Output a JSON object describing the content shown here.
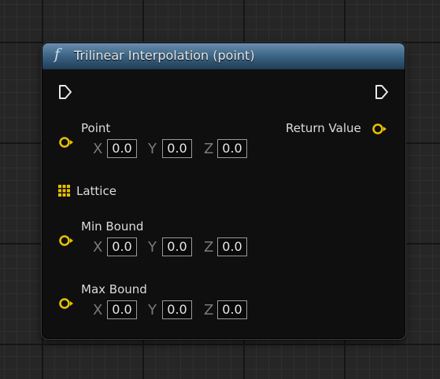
{
  "node": {
    "title": "Trilinear Interpolation (point)",
    "function_icon": "f",
    "header_color": "#3f6788",
    "pin_color": "#e8c000"
  },
  "inputs": {
    "point": {
      "label": "Point",
      "x_label": "X",
      "y_label": "Y",
      "z_label": "Z",
      "x": "0.0",
      "y": "0.0",
      "z": "0.0",
      "icon": "vector-pin-icon"
    },
    "lattice": {
      "label": "Lattice",
      "icon": "lattice-grid-icon"
    },
    "min_bound": {
      "label": "Min Bound",
      "x_label": "X",
      "y_label": "Y",
      "z_label": "Z",
      "x": "0.0",
      "y": "0.0",
      "z": "0.0",
      "icon": "vector-pin-icon"
    },
    "max_bound": {
      "label": "Max Bound",
      "x_label": "X",
      "y_label": "Y",
      "z_label": "Z",
      "x": "0.0",
      "y": "0.0",
      "z": "0.0",
      "icon": "vector-pin-icon"
    }
  },
  "outputs": {
    "return_value": {
      "label": "Return Value",
      "icon": "vector-pin-icon"
    }
  },
  "exec": {
    "in_icon": "exec-in-icon",
    "out_icon": "exec-out-icon"
  }
}
